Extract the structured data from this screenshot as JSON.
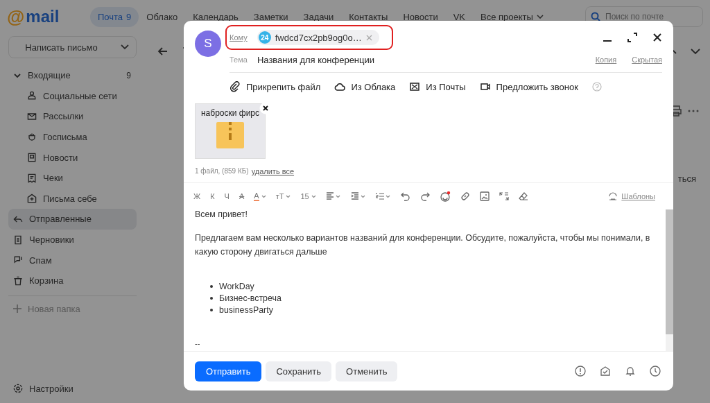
{
  "topbar": {
    "logo_at": "@",
    "logo": "mail",
    "tabs": [
      {
        "label": "Почта",
        "count": "9",
        "selected": true
      },
      {
        "label": "Облако",
        "selected": false
      },
      {
        "label": "Календарь",
        "selected": false
      },
      {
        "label": "Заметки",
        "selected": false
      },
      {
        "label": "Задачи",
        "selected": false
      },
      {
        "label": "Контакты",
        "selected": false
      },
      {
        "label": "Новости",
        "selected": false
      },
      {
        "label": "VK",
        "selected": false
      },
      {
        "label": "Все проекты",
        "selected": false,
        "dropdown": true
      }
    ],
    "search": {
      "placeholder": "Поиск по почте"
    }
  },
  "sidebar": {
    "compose": "Написать письмо",
    "folders": [
      {
        "label": "Входящие",
        "count": "9",
        "selected": false,
        "expanded": true,
        "children": [
          {
            "label": "Социальные сети",
            "selected": false
          },
          {
            "label": "Рассылки",
            "selected": false
          },
          {
            "label": "Госписьма",
            "selected": false
          },
          {
            "label": "Новости",
            "selected": false
          },
          {
            "label": "Чеки",
            "selected": false
          },
          {
            "label": "Письма себе",
            "selected": false
          }
        ]
      },
      {
        "label": "Отправленные",
        "selected": true
      },
      {
        "label": "Черновики",
        "selected": false
      },
      {
        "label": "Спам",
        "selected": false
      },
      {
        "label": "Корзина",
        "selected": false
      }
    ],
    "new_folder": "Новая папка",
    "settings": "Настройки"
  },
  "reading_pane": {
    "fragment": "ться"
  },
  "compose": {
    "avatar": "S",
    "to_label": "Кому",
    "recipient": {
      "badge": "24",
      "address": "fwdcd7cx2pb9og0o…",
      "highlighted": true
    },
    "subject_label": "Тема",
    "subject": "Названия для конференции",
    "cc": "Копия",
    "bcc": "Скрытая",
    "attach_actions": [
      "Прикрепить файл",
      "Из Облака",
      "Из Почты",
      "Предложить звонок"
    ],
    "attachment": {
      "name": "наброски фирс"
    },
    "attach_summary": "1 файл, (859 КБ)",
    "delete_all": "удалить все",
    "format": [
      {
        "kind": "plain",
        "label": "Ж"
      },
      {
        "kind": "plain",
        "label": "К"
      },
      {
        "kind": "plain",
        "label": "Ч"
      },
      {
        "kind": "strike",
        "label": "A"
      },
      {
        "kind": "color",
        "label": "A"
      },
      {
        "kind": "plain",
        "label": "тТ"
      },
      {
        "kind": "plain",
        "label": "15"
      }
    ],
    "templates": "Шаблоны",
    "body": {
      "greeting": "Всем привет!",
      "paragraph": "Предлагаем вам несколько вариантов названий для конференции. Обсудите, пожалуйста, чтобы мы понимали, в какую сторону двигаться дальше",
      "list": [
        "WorkDay",
        "Бизнес-встреча",
        "businessParty"
      ],
      "signature_sep": "--"
    },
    "buttons": [
      {
        "label": "Отправить",
        "kind": "primary"
      },
      {
        "label": "Сохранить",
        "kind": "secondary"
      },
      {
        "label": "Отменить",
        "kind": "secondary"
      }
    ]
  }
}
